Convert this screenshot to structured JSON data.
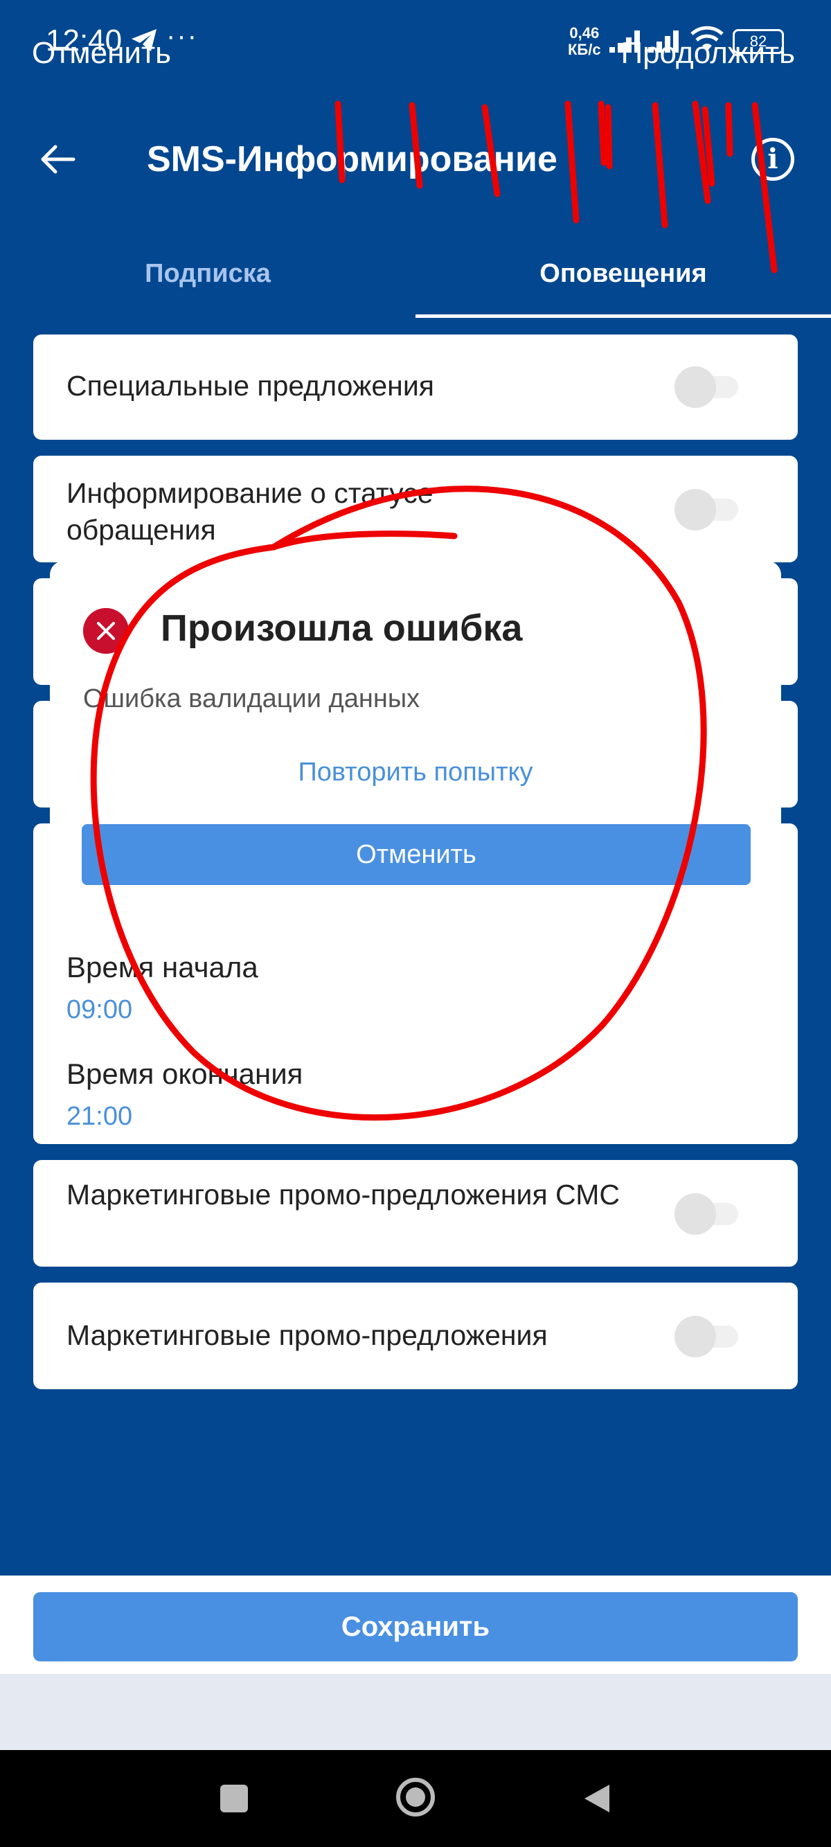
{
  "status_bar": {
    "time": "12:40",
    "more": "···",
    "overlay_cancel": "Отменить",
    "overlay_continue": "Продолжить",
    "speed_value": "0,46",
    "speed_unit": "КБ/с",
    "battery": "82"
  },
  "app_bar": {
    "title": "SMS-Информирование",
    "back_icon": "arrow-left-icon",
    "info_icon": "info-icon",
    "info_glyph": "i"
  },
  "tabs": [
    {
      "label": "Подписка",
      "active": false
    },
    {
      "label": "Оповещения",
      "active": true
    }
  ],
  "settings": {
    "special_offers": {
      "label": "Специальные предложения",
      "enabled": false
    },
    "request_status": {
      "label": "Информирование о статусе обращения",
      "enabled": false
    },
    "start_time": {
      "label": "Время начала",
      "value": "09:00"
    },
    "end_time": {
      "label": "Время окончания",
      "value": "21:00"
    },
    "promo_sms": {
      "label": "Маркетинговые промо-предложения СМС",
      "enabled": false
    },
    "promo": {
      "label": "Маркетинговые промо-предложения",
      "enabled": false
    }
  },
  "dialog": {
    "title": "Произошла ошибка",
    "message": "Ошибка валидации данных",
    "retry_label": "Повторить попытку",
    "cancel_label": "Отменить"
  },
  "footer": {
    "save_label": "Сохранить"
  },
  "colors": {
    "header_bg": "#02478f",
    "accent": "#4a90e2",
    "link": "#4a90d9",
    "error": "#c8102e",
    "annotation": "#ee0000"
  }
}
